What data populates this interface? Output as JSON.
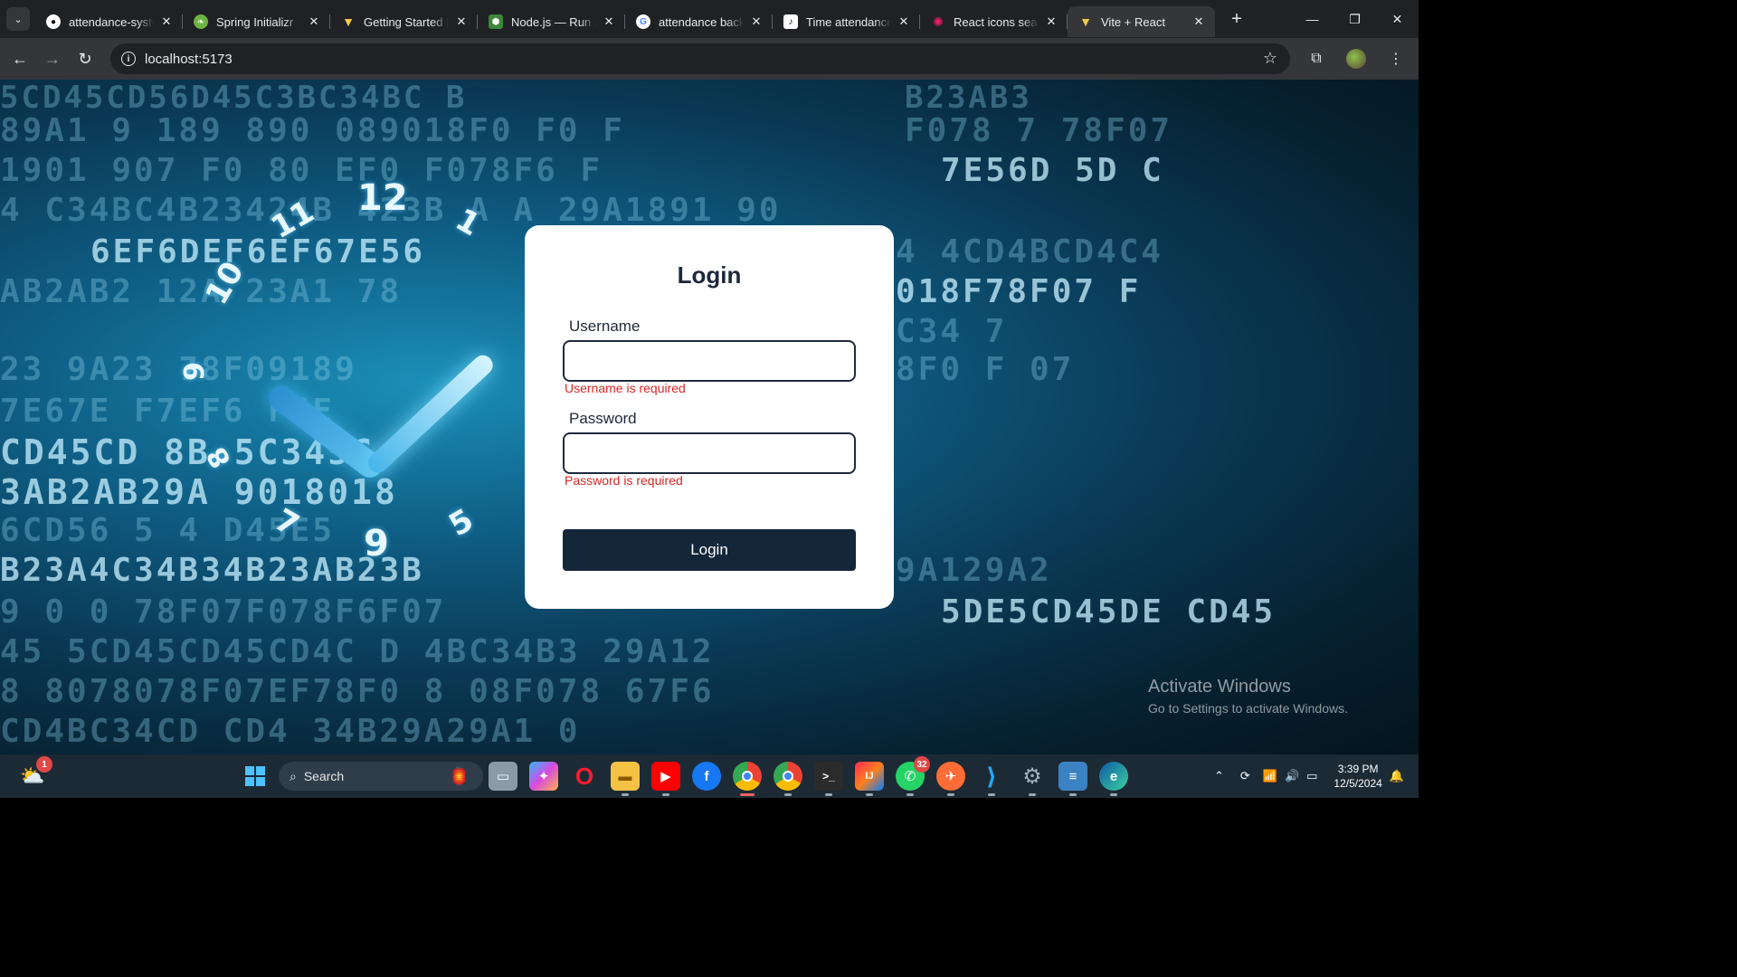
{
  "browser": {
    "tabs": [
      {
        "title": "attendance-syste",
        "icon": "github-icon",
        "color": "#ffffff"
      },
      {
        "title": "Spring Initializr",
        "icon": "spring-icon",
        "color": "#6db33f"
      },
      {
        "title": "Getting Started |",
        "icon": "vite-icon",
        "color": "#bd34fe"
      },
      {
        "title": "Node.js — Run J",
        "icon": "nodejs-icon",
        "color": "#3c873a"
      },
      {
        "title": "attendance back",
        "icon": "google-icon",
        "color": "#4285f4"
      },
      {
        "title": "Time attendance",
        "icon": "tiktok-icon",
        "color": "#ffffff"
      },
      {
        "title": "React icons sear",
        "icon": "react-icons-icon",
        "color": "#e91e63"
      },
      {
        "title": "Vite + React",
        "icon": "vite-icon",
        "color": "#bd34fe"
      }
    ],
    "active_tab": 7,
    "url": "localhost:5173"
  },
  "login": {
    "title": "Login",
    "username_label": "Username",
    "username_error": "Username is required",
    "password_label": "Password",
    "password_error": "Password is required",
    "button_label": "Login"
  },
  "watermark": {
    "line1": "Activate Windows",
    "line2": "Go to Settings to activate Windows."
  },
  "taskbar": {
    "search_placeholder": "Search",
    "weather_badge": "1",
    "whatsapp_badge": "32",
    "time": "3:39 PM",
    "date": "12/5/2024"
  }
}
